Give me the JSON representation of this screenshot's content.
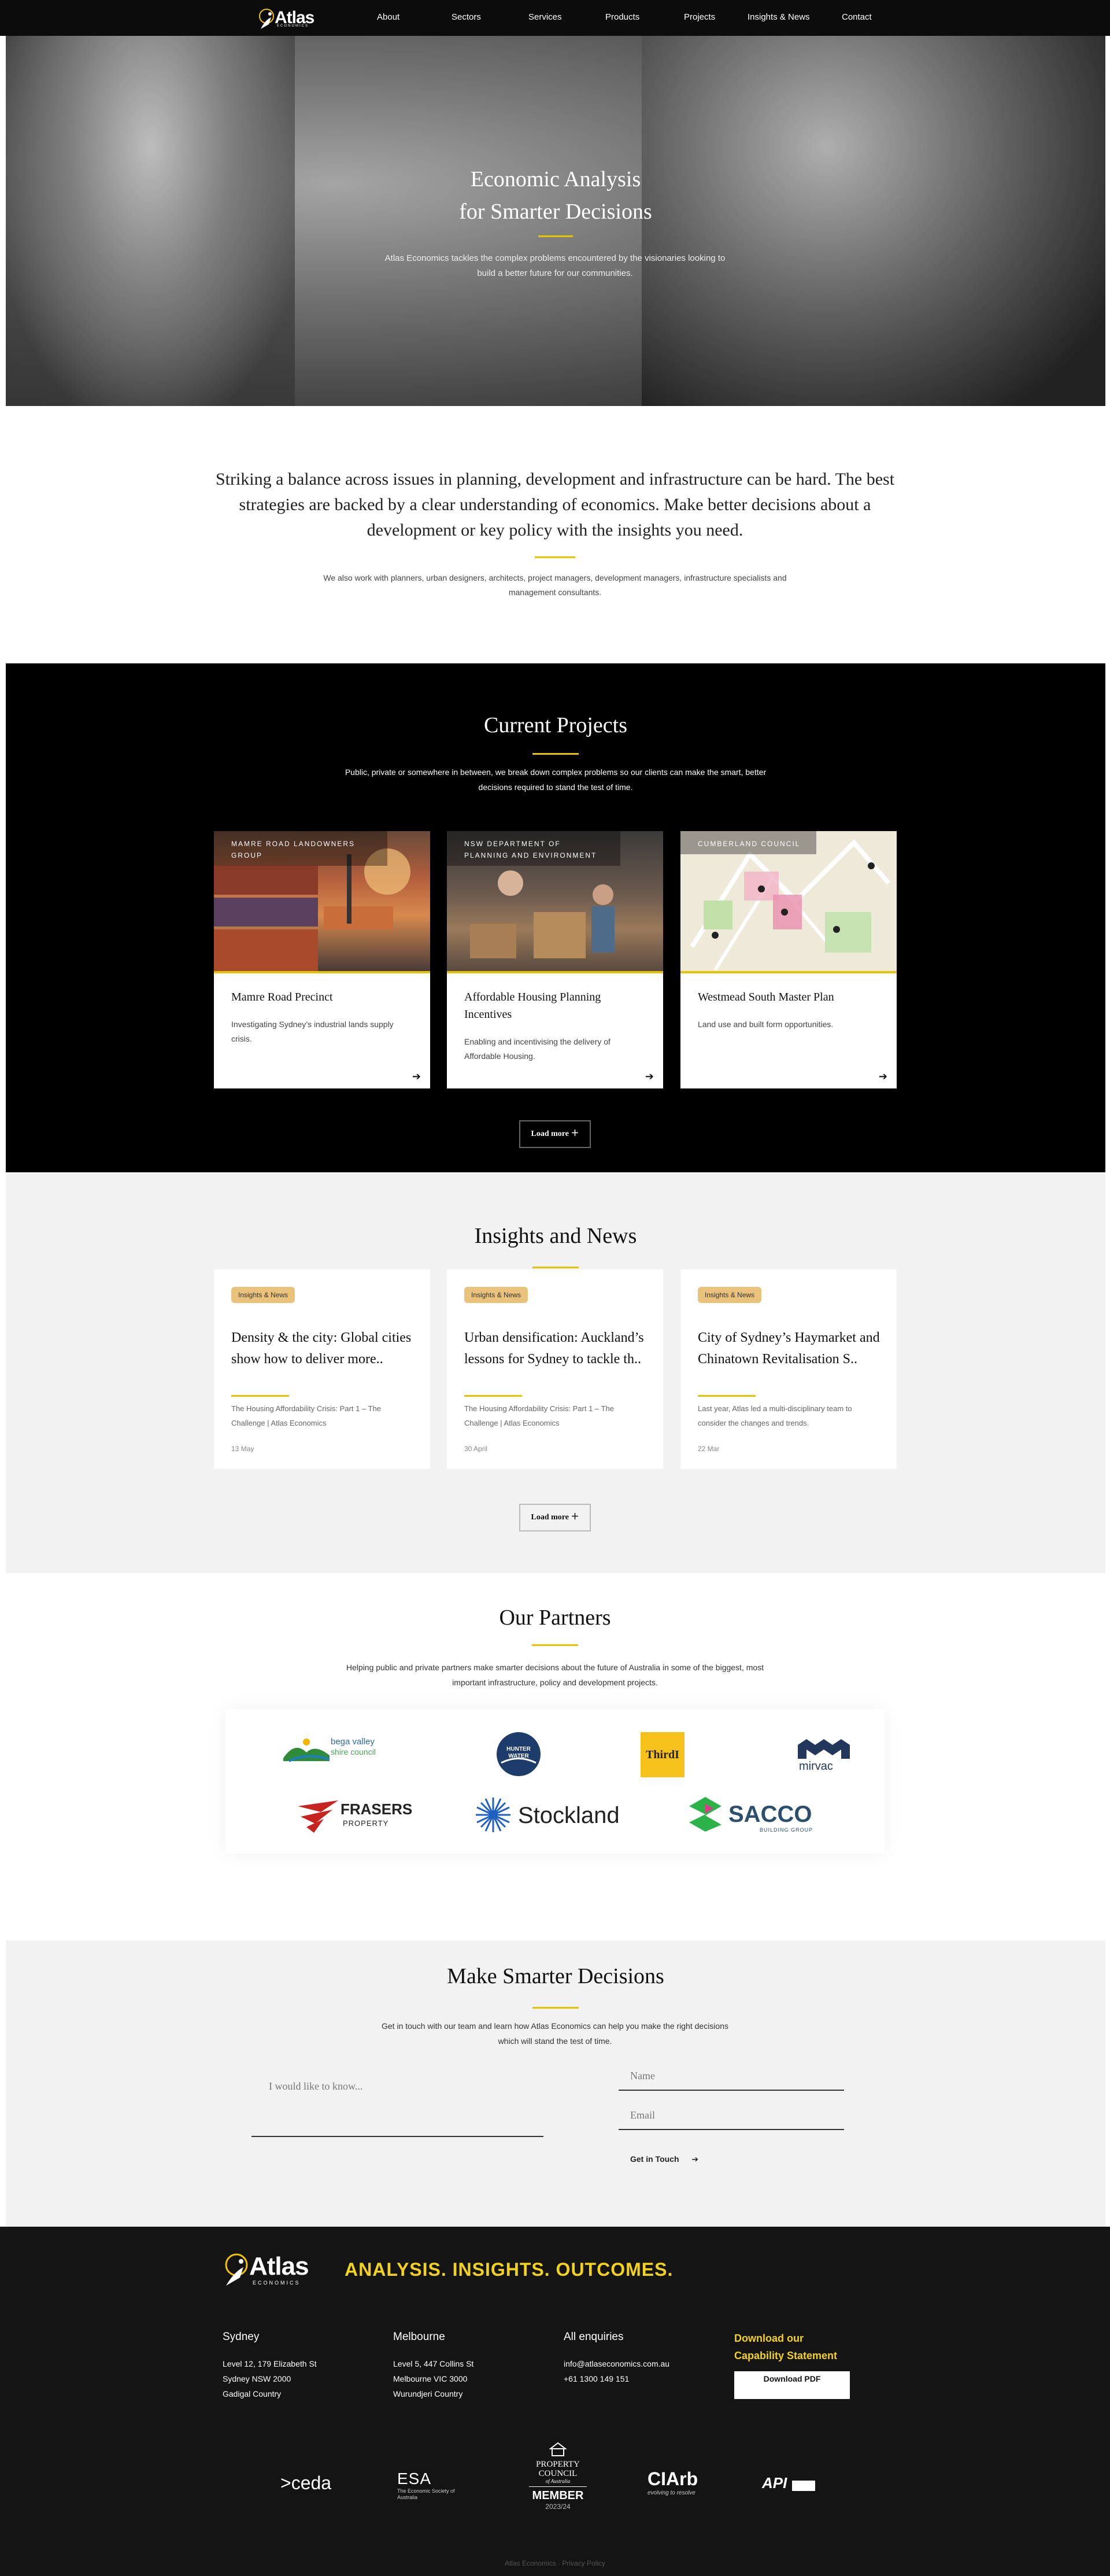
{
  "nav": {
    "logo": "Atlas",
    "logo_sub": "ECONOMICS",
    "items": [
      "About",
      "Sectors",
      "Services",
      "Products",
      "Projects",
      "Insights & News",
      "Contact"
    ]
  },
  "hero": {
    "title_line1": "Economic Analysis",
    "title_line2": "for Smarter Decisions",
    "subtitle": "Atlas Economics tackles the complex problems encountered by the visionaries looking to build a better future for our communities."
  },
  "intro": {
    "headline": "Striking a balance across issues in planning, development and infrastructure can be hard. The best strategies are backed by a clear understanding of economics. Make better decisions about a development or key policy with the insights you need.",
    "body": "We also work with planners, urban designers, architects, project managers, development managers, infrastructure specialists and management consultants."
  },
  "projects": {
    "title": "Current Projects",
    "subtitle": "Public, private or somewhere in between, we break down complex problems so our clients can make the smart, better decisions required to stand the test of time.",
    "cards": [
      {
        "tag": "MAMRE ROAD LANDOWNERS GROUP",
        "title": "Mamre Road Precinct",
        "desc": "Investigating Sydney’s industrial lands supply crisis."
      },
      {
        "tag": "NSW DEPARTMENT OF PLANNING AND ENVIRONMENT",
        "title": "Affordable Housing Planning Incentives",
        "desc": "Enabling and incentivising the delivery of Affordable Housing."
      },
      {
        "tag": "CUMBERLAND COUNCIL",
        "title": "Westmead South Master Plan",
        "desc": "Land use and built form opportunities."
      }
    ],
    "load_more": "Load more"
  },
  "insights": {
    "title": "Insights and News",
    "cards": [
      {
        "badge": "Insights & News",
        "title": "Density & the city: Global cities show how to deliver more..",
        "excerpt": "The Housing Affordability Crisis: Part 1 – The Challenge | Atlas Economics",
        "date": "13 May"
      },
      {
        "badge": "Insights & News",
        "title": "Urban densification: Auckland’s lessons for Sydney to tackle th..",
        "excerpt": "The Housing Affordability Crisis: Part 1 – The Challenge | Atlas Economics",
        "date": "30 April"
      },
      {
        "badge": "Insights & News",
        "title": "City of Sydney’s Haymarket and Chinatown Revitalisation S..",
        "excerpt": "Last year, Atlas led a multi-disciplinary team to consider the changes and trends.",
        "date": "22 Mar"
      }
    ],
    "load_more": "Load more"
  },
  "partners": {
    "title": "Our Partners",
    "subtitle": "Helping public and private partners make smarter decisions about the future of Australia in some of the biggest, most important infrastructure, policy and development projects.",
    "logos": {
      "bega_line1": "bega valley",
      "bega_line2": "shire council",
      "hunter_line1": "HUNTER",
      "hunter_line2": "WATER",
      "third": "ThirdI",
      "mirvac": "mirvac",
      "frasers_line1": "FRASERS",
      "frasers_line2": "PROPERTY",
      "stockland": "Stockland",
      "sacco": "SACCO",
      "sacco_sub": "BUILDING GROUP"
    }
  },
  "contact": {
    "title": "Make Smarter Decisions",
    "subtitle": "Get in touch with our team and learn how Atlas Economics can help you make the right decisions which will stand the test of time.",
    "message_placeholder": "I would like to know...",
    "name_placeholder": "Name",
    "email_placeholder": "Email",
    "submit": "Get in Touch"
  },
  "footer": {
    "logo": "Atlas",
    "logo_sub": "ECONOMICS",
    "slogan": "ANALYSIS. INSIGHTS. OUTCOMES.",
    "sydney": {
      "title": "Sydney",
      "l1": "Level 12, 179 Elizabeth St",
      "l2": "Sydney NSW 2000",
      "l3": "Gadigal Country"
    },
    "melbourne": {
      "title": "Melbourne",
      "l1": "Level 5, 447 Collins St",
      "l2": "Melbourne VIC 3000",
      "l3": "Wurundjeri Country"
    },
    "enquiries": {
      "title": "All enquiries",
      "email": "info@atlaseconomics.com.au",
      "phone": "+61 1300 149 151"
    },
    "download": {
      "title_line1": "Download our",
      "title_line2": "Capability Statement",
      "button": "Download PDF"
    },
    "badges": {
      "ceda": ">ceda",
      "esa": "ESA",
      "esa_sub": "The Economic Society of Australia",
      "pca_line1": "PROPERTY",
      "pca_line2": "COUNCIL",
      "pca_line3": "of Australia",
      "pca_member": "MEMBER",
      "pca_year": "2023/24",
      "ciarb": "CIArb",
      "ciarb_sub": "evolving to resolve",
      "api": "API"
    },
    "copyright": "Atlas Economics · Privacy Policy"
  }
}
